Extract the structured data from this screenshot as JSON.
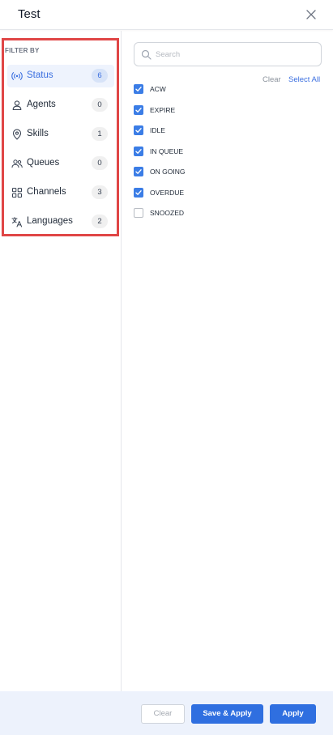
{
  "header": {
    "title": "Test",
    "close_icon": "close-icon"
  },
  "sidebar": {
    "section_label": "FILTER BY",
    "items": [
      {
        "label": "Status",
        "count": "6",
        "icon": "broadcast-icon",
        "active": true
      },
      {
        "label": "Agents",
        "count": "0",
        "icon": "user-icon",
        "active": false
      },
      {
        "label": "Skills",
        "count": "1",
        "icon": "location-pin-icon",
        "active": false
      },
      {
        "label": "Queues",
        "count": "0",
        "icon": "users-group-icon",
        "active": false
      },
      {
        "label": "Channels",
        "count": "3",
        "icon": "grid-icon",
        "active": false
      },
      {
        "label": "Languages",
        "count": "2",
        "icon": "translate-icon",
        "active": false
      }
    ]
  },
  "main": {
    "search": {
      "placeholder": "Search",
      "value": ""
    },
    "clear_label": "Clear",
    "select_all_label": "Select All",
    "options": [
      {
        "label": "ACW",
        "checked": true
      },
      {
        "label": "EXPIRE",
        "checked": true
      },
      {
        "label": "IDLE",
        "checked": true
      },
      {
        "label": "IN QUEUE",
        "checked": true
      },
      {
        "label": "ON GOING",
        "checked": true
      },
      {
        "label": "OVERDUE",
        "checked": true
      },
      {
        "label": "SNOOZED",
        "checked": false
      }
    ]
  },
  "footer": {
    "clear_label": "Clear",
    "save_apply_label": "Save & Apply",
    "apply_label": "Apply"
  },
  "colors": {
    "accent": "#2f6fe0",
    "active_bg": "#eef3fd",
    "footer_bg": "#edf2fc",
    "highlight_border": "#e04646"
  }
}
